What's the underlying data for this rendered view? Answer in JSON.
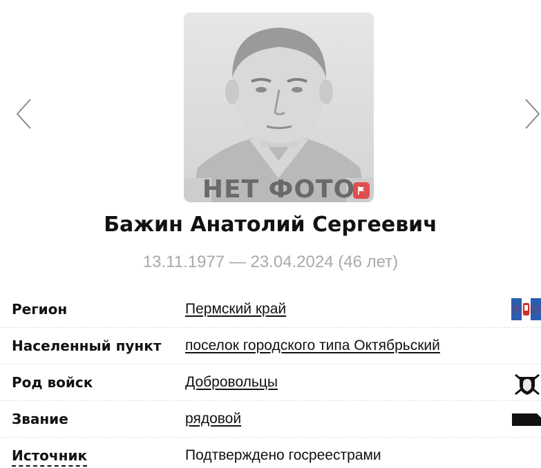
{
  "navigation": {
    "prev_icon": "chevron-left-icon",
    "next_icon": "chevron-right-icon"
  },
  "photo": {
    "placeholder_label": "НЕТ ФОТО",
    "report_icon": "flag-icon",
    "report_color": "#e04f4f"
  },
  "person": {
    "name": "Бажин Анатолий Сергеевич",
    "dates": "13.11.1977 — 23.04.2024 (46 лет)"
  },
  "details": {
    "region": {
      "label": "Регион",
      "value": "Пермский край",
      "icon": "perm-krai-flag-icon"
    },
    "settlement": {
      "label": "Населенный пункт",
      "value": "поселок городского типа Октябрьский"
    },
    "troops": {
      "label": "Род войск",
      "value": "Добровольцы",
      "icon": "volunteers-emblem-icon"
    },
    "rank": {
      "label": "Звание",
      "value": "рядовой",
      "icon": "rank-insignia-icon"
    },
    "source": {
      "label": "Источник",
      "value": "Подтверждено госреестрами"
    }
  },
  "colors": {
    "dates_text": "#a9a9a9",
    "flag_blue": "#2a5db0",
    "flag_red": "#d22b2b"
  }
}
